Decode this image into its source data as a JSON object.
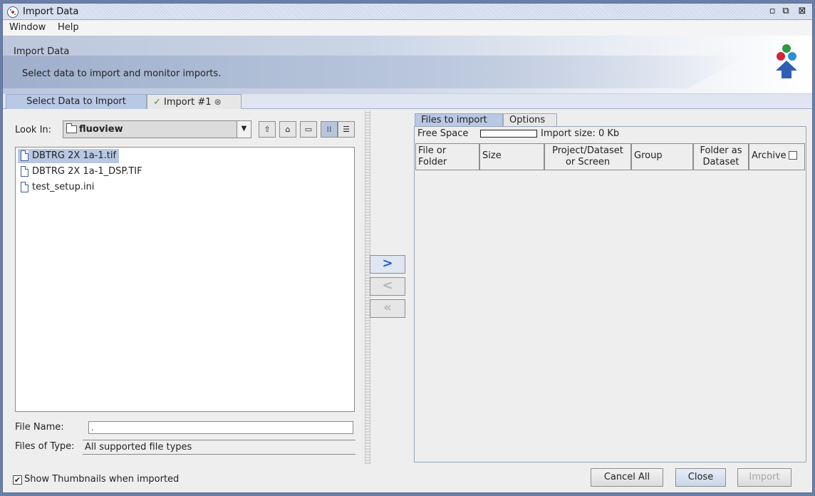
{
  "window": {
    "title": "Import Data",
    "controls": [
      "minimize",
      "maximize",
      "close"
    ]
  },
  "menu": {
    "items": [
      "Window",
      "Help"
    ]
  },
  "header": {
    "title": "Import Data",
    "subtitle": "Select data to import and monitor imports."
  },
  "tabs": [
    {
      "label": "Select Data to Import",
      "active": true
    },
    {
      "label": "Import #1",
      "status_icon": "check-icon",
      "closable": true
    }
  ],
  "chooser": {
    "look_in_label": "Look In:",
    "look_in_value": "fluoview",
    "toolbar_icons": [
      "up-folder-icon",
      "home-icon",
      "new-folder-icon",
      "list-view-icon",
      "details-view-icon"
    ],
    "files": [
      "DBTRG 2X 1a-1.tif",
      "DBTRG 2X 1a-1_DSP.TIF",
      "test_setup.ini"
    ],
    "selected_file": "DBTRG 2X 1a-1.tif",
    "file_name_label": "File Name:",
    "file_name_value": ".",
    "file_type_label": "Files of Type:",
    "file_type_value": "All supported file types"
  },
  "move_buttons": [
    {
      "glyph": ">",
      "enabled": true
    },
    {
      "glyph": "<",
      "enabled": false
    },
    {
      "glyph": "«",
      "enabled": false
    }
  ],
  "right_tabs": [
    "Files to import",
    "Options"
  ],
  "queue": {
    "free_space_label": "Free Space",
    "import_size_label": "Import size: 0 Kb",
    "columns": [
      "File or Folder",
      "Size",
      "Project/Dataset or Screen",
      "Group",
      "Folder as Dataset",
      "Archive"
    ],
    "rows": []
  },
  "footer": {
    "thumbnails_label": "Show Thumbnails when imported",
    "thumbnails_checked": true,
    "buttons": [
      "Cancel All",
      "Close",
      "Import"
    ]
  },
  "colors": {
    "accent": "#b9c9e4",
    "arrow": "#2a5ad0"
  }
}
